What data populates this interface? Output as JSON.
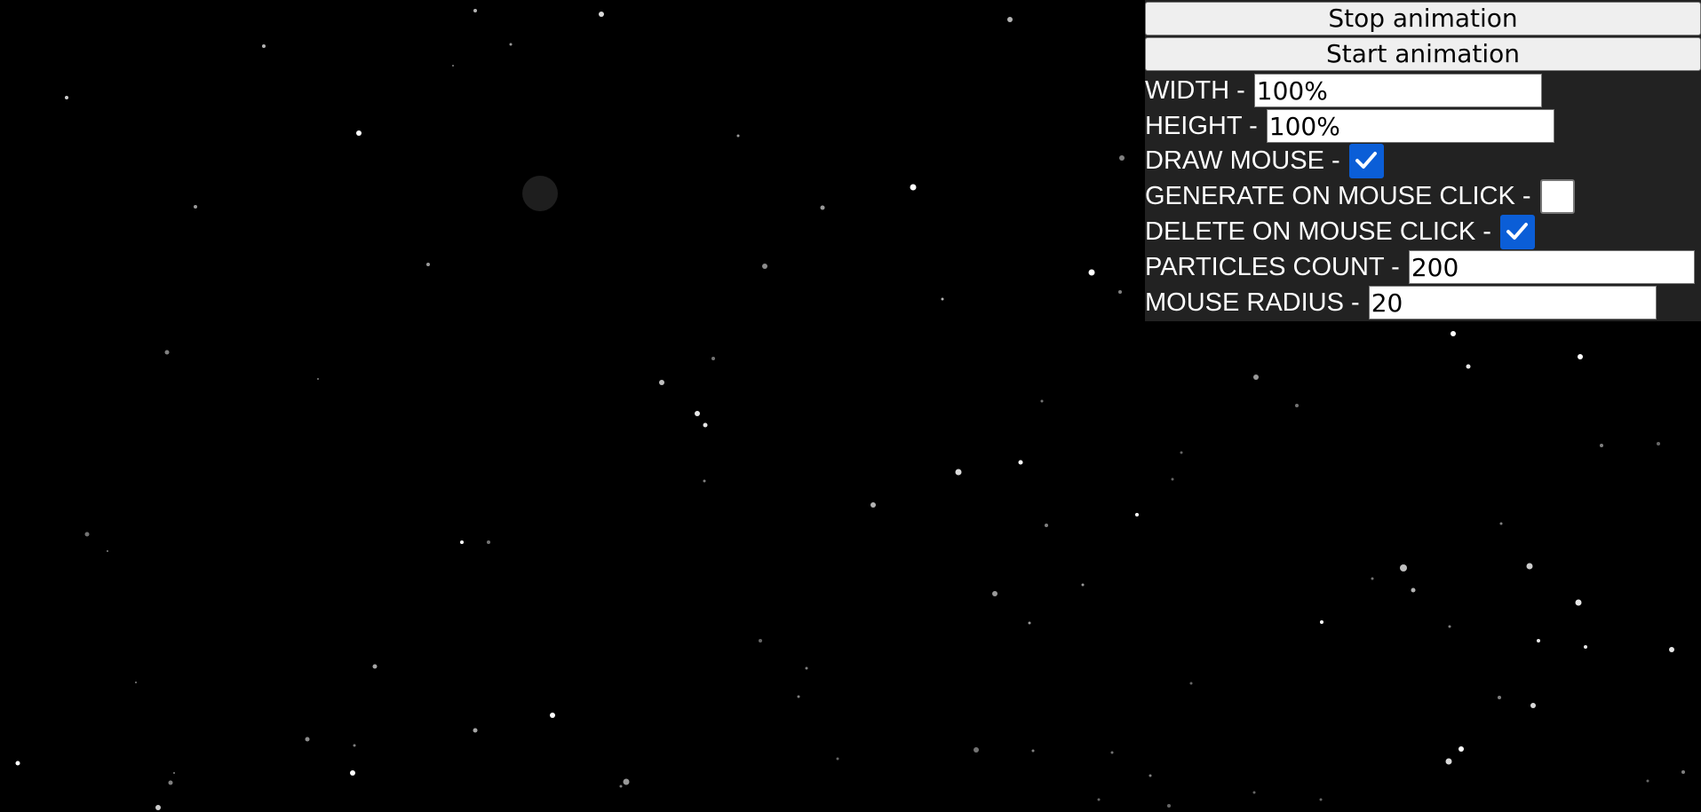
{
  "controls": {
    "stop_label": "Stop animation",
    "start_label": "Start animation",
    "width": {
      "label": "WIDTH -",
      "value": "100%"
    },
    "height": {
      "label": "HEIGHT -",
      "value": "100%"
    },
    "draw_mouse": {
      "label": "DRAW MOUSE -",
      "checked": true
    },
    "generate_on_click": {
      "label": "GENERATE ON MOUSE CLICK -",
      "checked": false
    },
    "delete_on_click": {
      "label": "DELETE ON MOUSE CLICK -",
      "checked": true
    },
    "particles_count": {
      "label": "PARTICLES COUNT -",
      "value": "200"
    },
    "mouse_radius": {
      "label": "MOUSE RADIUS -",
      "value": "20"
    }
  },
  "colors": {
    "background": "#000000",
    "panel": "#222222",
    "checkbox_accent": "#0b5ed7",
    "particle": "#ffffff",
    "mouse_circle": "#1e1e1e"
  },
  "icons": {
    "checkmark": "checkmark-icon"
  }
}
